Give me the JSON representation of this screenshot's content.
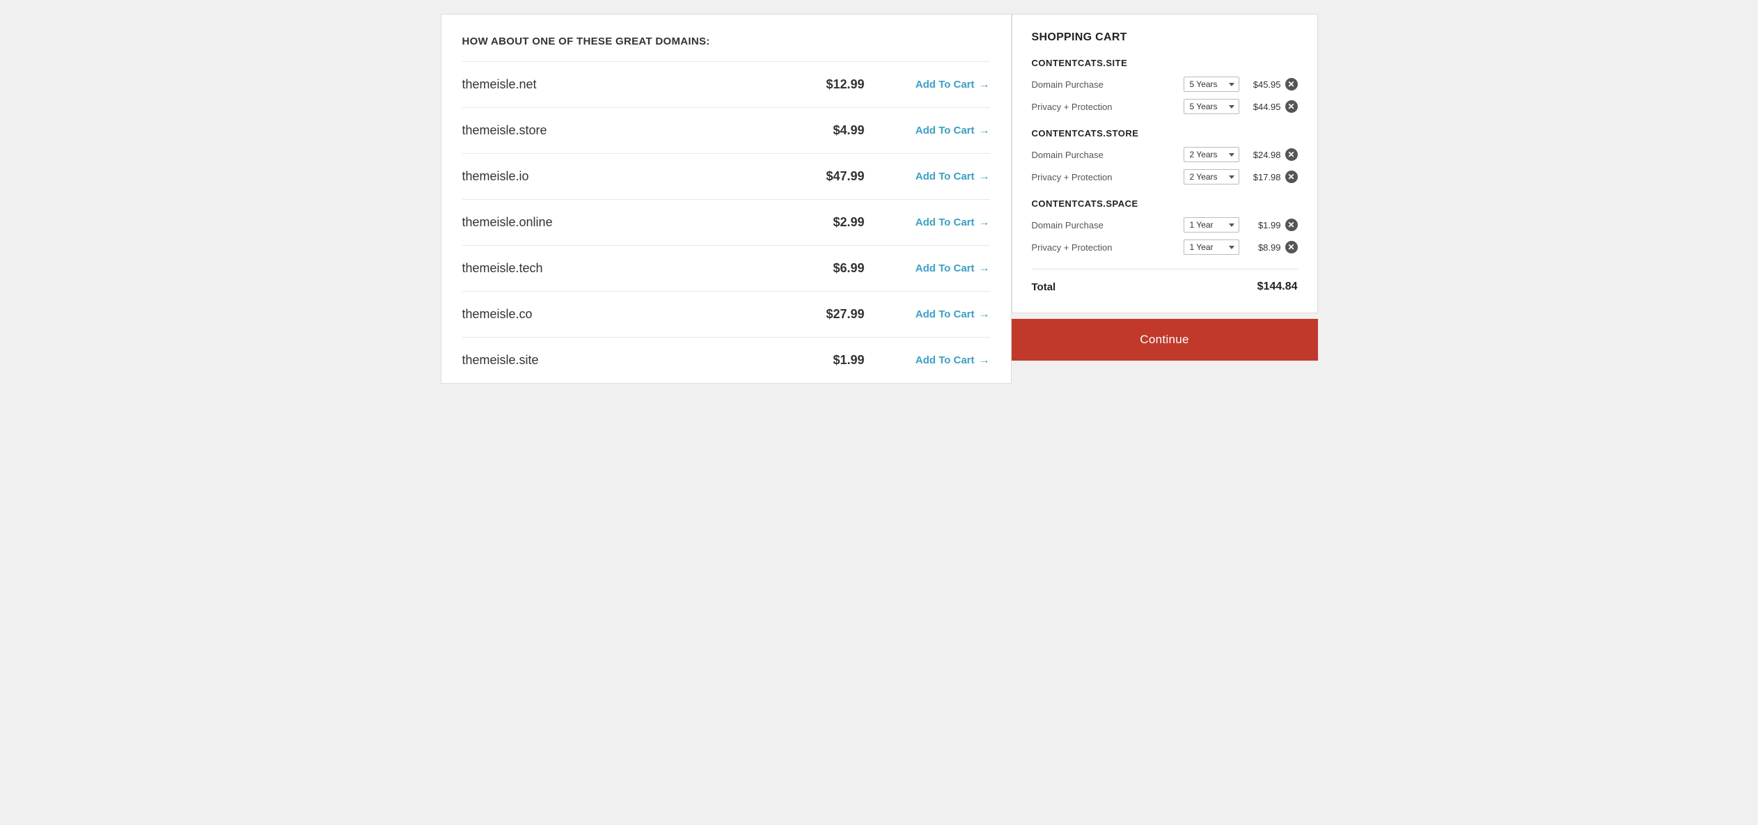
{
  "left_panel": {
    "heading": "HOW ABOUT ONE OF THESE GREAT DOMAINS:",
    "domains": [
      {
        "name": "themeisle.net",
        "price": "$12.99",
        "btn_label": "Add To Cart"
      },
      {
        "name": "themeisle.store",
        "price": "$4.99",
        "btn_label": "Add To Cart"
      },
      {
        "name": "themeisle.io",
        "price": "$47.99",
        "btn_label": "Add To Cart"
      },
      {
        "name": "themeisle.online",
        "price": "$2.99",
        "btn_label": "Add To Cart"
      },
      {
        "name": "themeisle.tech",
        "price": "$6.99",
        "btn_label": "Add To Cart"
      },
      {
        "name": "themeisle.co",
        "price": "$27.99",
        "btn_label": "Add To Cart"
      },
      {
        "name": "themeisle.site",
        "price": "$1.99",
        "btn_label": "Add To Cart"
      }
    ]
  },
  "cart": {
    "heading": "SHOPPING CART",
    "sections": [
      {
        "title": "CONTENTCATS.SITE",
        "items": [
          {
            "label": "Domain Purchase",
            "duration": "5 Years",
            "price": "$45.95"
          },
          {
            "label": "Privacy + Protection",
            "duration": "5 Years",
            "price": "$44.95"
          }
        ]
      },
      {
        "title": "CONTENTCATS.STORE",
        "items": [
          {
            "label": "Domain Purchase",
            "duration": "2 Years",
            "price": "$24.98"
          },
          {
            "label": "Privacy + Protection",
            "duration": "2 Years",
            "price": "$17.98"
          }
        ]
      },
      {
        "title": "CONTENTCATS.SPACE",
        "items": [
          {
            "label": "Domain Purchase",
            "duration": "1 Year",
            "price": "$1.99"
          },
          {
            "label": "Privacy + Protection",
            "duration": "1 Year",
            "price": "$8.99"
          }
        ]
      }
    ],
    "total_label": "Total",
    "total_value": "$144.84",
    "continue_label": "Continue"
  }
}
